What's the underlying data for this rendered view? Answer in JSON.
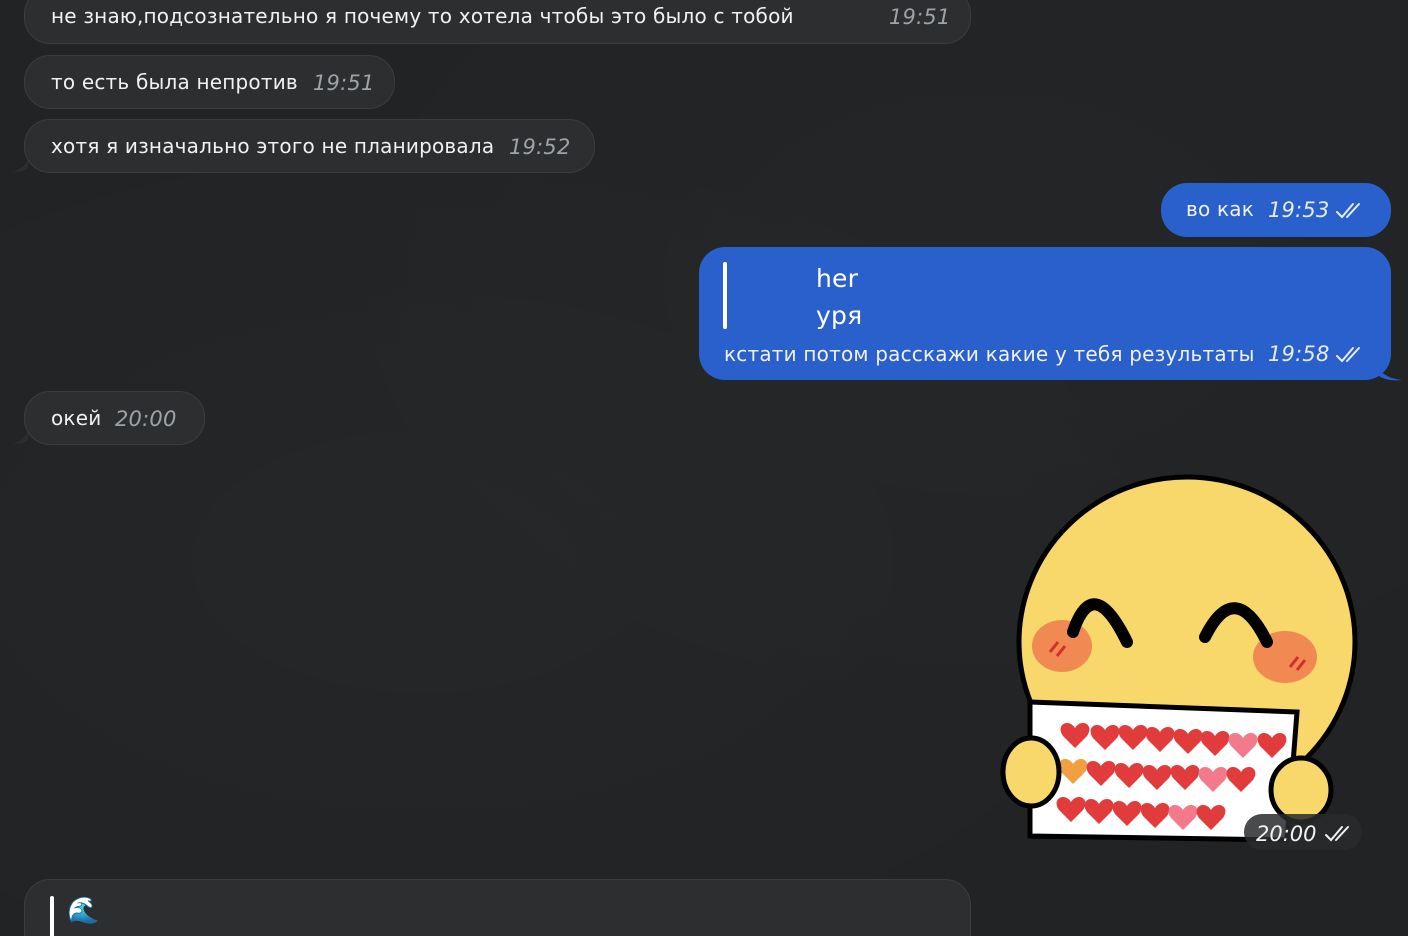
{
  "messages": [
    {
      "direction": "incoming",
      "text": "не знаю,подсознательно я почему то хотела чтобы это было с тобой",
      "time": "19:51"
    },
    {
      "direction": "incoming",
      "text": "то есть была непротив",
      "time": "19:51"
    },
    {
      "direction": "incoming",
      "text": "хотя я изначально этого не планировала",
      "time": "19:52"
    },
    {
      "direction": "outgoing",
      "text": "во как",
      "time": "19:53",
      "status": "read"
    },
    {
      "direction": "outgoing",
      "reply_to": {
        "author": "her",
        "text": "уря"
      },
      "text": "кстати потом расскажи какие у тебя результаты",
      "time": "19:58",
      "status": "read"
    },
    {
      "direction": "incoming",
      "text": "окей",
      "time": "20:00"
    },
    {
      "direction": "outgoing",
      "type": "sticker",
      "sticker": "blushing-emoji-holding-hearts-sign",
      "time": "20:00",
      "status": "read"
    },
    {
      "direction": "incoming",
      "partial": true,
      "reply_emoji": "🌊"
    }
  ],
  "colors": {
    "background": "#212325",
    "incoming_bubble": "#2c2e30",
    "outgoing_bubble": "#2a60cc",
    "timestamp_incoming": "#9ea3a9"
  }
}
